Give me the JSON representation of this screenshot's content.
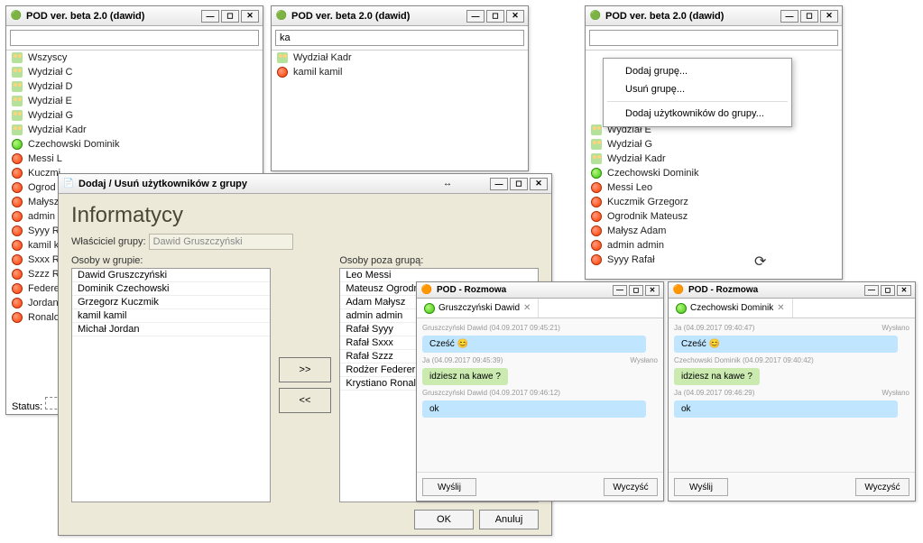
{
  "app_title": "POD ver. beta 2.0 (dawid)",
  "win1": {
    "search_value": "",
    "items": [
      {
        "icon": "group",
        "label": "Wszyscy"
      },
      {
        "icon": "group",
        "label": "Wydział C"
      },
      {
        "icon": "group",
        "label": "Wydział D"
      },
      {
        "icon": "group",
        "label": "Wydział E"
      },
      {
        "icon": "group",
        "label": "Wydział G"
      },
      {
        "icon": "group",
        "label": "Wydział Kadr"
      },
      {
        "icon": "online",
        "label": "Czechowski Dominik"
      },
      {
        "icon": "offline",
        "label": "Messi L"
      },
      {
        "icon": "offline",
        "label": "Kuczmi"
      },
      {
        "icon": "offline",
        "label": "Ogrod"
      },
      {
        "icon": "offline",
        "label": "Małysz"
      },
      {
        "icon": "offline",
        "label": "admin"
      },
      {
        "icon": "offline",
        "label": "Syyy R"
      },
      {
        "icon": "offline",
        "label": "kamil k"
      },
      {
        "icon": "offline",
        "label": "Sxxx R"
      },
      {
        "icon": "offline",
        "label": "Szzz R"
      },
      {
        "icon": "offline",
        "label": "Federe"
      },
      {
        "icon": "offline",
        "label": "Jordan"
      },
      {
        "icon": "offline",
        "label": "Ronalo"
      }
    ],
    "status_label": "Status:"
  },
  "win2": {
    "search_value": "ka",
    "items": [
      {
        "icon": "group",
        "label": "Wydział Kadr"
      },
      {
        "icon": "offline",
        "label": "kamil kamil"
      }
    ]
  },
  "win3": {
    "items": [
      {
        "icon": "group",
        "label": "Wydział E"
      },
      {
        "icon": "group",
        "label": "Wydział G"
      },
      {
        "icon": "group",
        "label": "Wydział Kadr"
      },
      {
        "icon": "online",
        "label": "Czechowski Dominik"
      },
      {
        "icon": "offline",
        "label": "Messi Leo"
      },
      {
        "icon": "offline",
        "label": "Kuczmik Grzegorz"
      },
      {
        "icon": "offline",
        "label": "Ogrodnik Mateusz"
      },
      {
        "icon": "offline",
        "label": "Małysz Adam"
      },
      {
        "icon": "offline",
        "label": "admin admin"
      },
      {
        "icon": "offline",
        "label": "Syyy Rafał"
      }
    ],
    "context_menu": {
      "items": [
        "Dodaj grupę...",
        "Usuń grupę...",
        "Dodaj użytkowników do grupy..."
      ]
    }
  },
  "dialog": {
    "title": "Dodaj / Usuń użytkowników z grupy",
    "heading": "Informatycy",
    "owner_label": "Właściciel grupy:",
    "owner_value": "Dawid Gruszczyński",
    "left_label": "Osoby w grupie:",
    "right_label": "Osoby poza grupą:",
    "add_btn": ">>",
    "remove_btn": "<<",
    "ok_btn": "OK",
    "cancel_btn": "Anuluj",
    "people_in": [
      "Dawid Gruszczyński",
      "Dominik Czechowski",
      "Grzegorz Kuczmik",
      "kamil kamil",
      "Michał Jordan"
    ],
    "people_out": [
      "Leo Messi",
      "Mateusz Ogrodnik",
      "Adam Małysz",
      "admin admin",
      "Rafał Syyy",
      "Rafał Sxxx",
      "Rafał Szzz",
      "Rodżer Federer",
      "Krystiano Ronaldo"
    ]
  },
  "chat_title": "POD - Rozmowa",
  "chat1": {
    "tab_label": "Gruszczyński Dawid",
    "messages": [
      {
        "meta_l": "Gruszczyński Dawid (04.09.2017 09:45:21)",
        "meta_r": "",
        "text": "Cześć 😊",
        "style": "b-blue"
      },
      {
        "meta_l": "Ja (04.09.2017 09:45:39)",
        "meta_r": "Wysłano",
        "text": "idziesz na kawe ?",
        "style": "b-green"
      },
      {
        "meta_l": "Gruszczyński Dawid (04.09.2017 09:46:12)",
        "meta_r": "",
        "text": "ok",
        "style": "b-blue2"
      }
    ],
    "send_btn": "Wyślij",
    "clear_btn": "Wyczyść"
  },
  "chat2": {
    "tab_label": "Czechowski Dominik",
    "messages": [
      {
        "meta_l": "Ja (04.09.2017 09:40:47)",
        "meta_r": "Wysłano",
        "text": "Cześć 😊",
        "style": "b-blue"
      },
      {
        "meta_l": "Czechowski Dominik (04.09.2017 09:40:42)",
        "meta_r": "",
        "text": "idziesz na kawe ?",
        "style": "b-green"
      },
      {
        "meta_l": "Ja (04.09.2017 09:46:29)",
        "meta_r": "Wysłano",
        "text": "ok",
        "style": "b-blue2"
      }
    ],
    "send_btn": "Wyślij",
    "clear_btn": "Wyczyść"
  }
}
